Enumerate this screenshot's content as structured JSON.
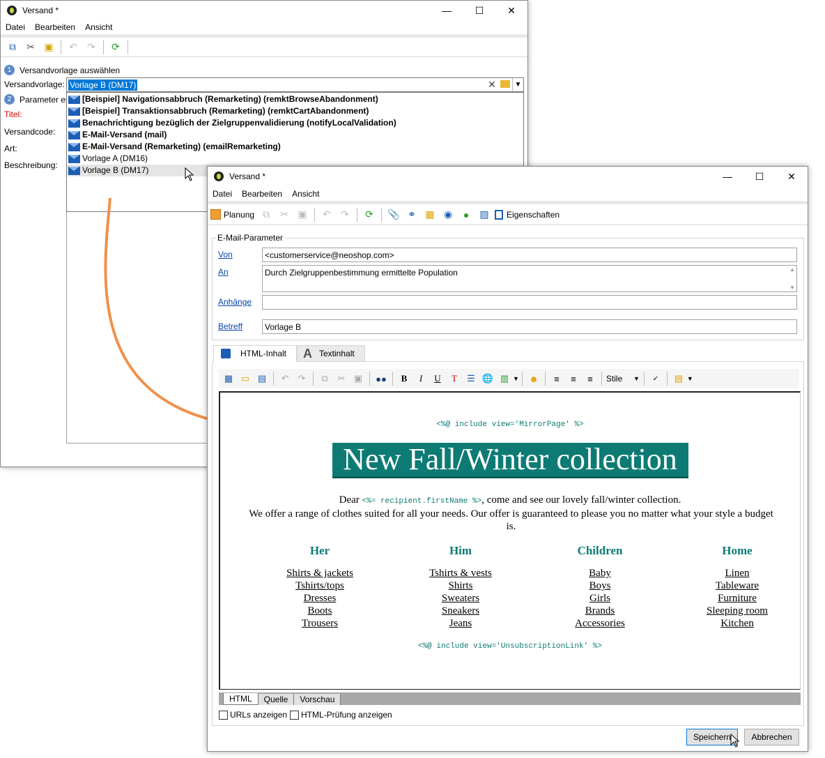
{
  "win1": {
    "title": "Versand *",
    "menu": [
      "Datei",
      "Bearbeiten",
      "Ansicht"
    ],
    "step1": {
      "num": "1",
      "label": "Versandvorlage auswählen"
    },
    "step2": {
      "num": "2",
      "label": "Parameter er"
    },
    "labels": {
      "template": "Versandvorlage:",
      "title": "Titel:",
      "code": "Versandcode:",
      "kind": "Art:",
      "desc": "Beschreibung:"
    },
    "template_value": "Vorlage B (DM17)",
    "dropdown": [
      "[Beispiel] Navigationsabbruch (Remarketing) (remktBrowseAbandonment)",
      "[Beispiel] Transaktionsabbruch (Remarketing) (remktCartAbandonment)",
      "Benachrichtigung bezüglich der Zielgruppenvalidierung (notifyLocalValidation)",
      "E-Mail-Versand (mail)",
      "E-Mail-Versand (Remarketing) (emailRemarketing)",
      "Vorlage A (DM16)",
      "Vorlage B (DM17)"
    ]
  },
  "win2": {
    "title": "Versand *",
    "menu": [
      "Datei",
      "Bearbeiten",
      "Ansicht"
    ],
    "toolbar": {
      "plan": "Planung",
      "props": "Eigenschaften"
    },
    "group_label": "E-Mail-Parameter",
    "from_label": "Von",
    "from_value": "<customerservice@neoshop.com>",
    "to_label": "An",
    "to_value": "Durch Zielgruppenbestimmung ermittelte Population",
    "attach_label": "Anhänge",
    "subject_label": "Betreff",
    "subject_value": "Vorlage B",
    "tab_html": "HTML-Inhalt",
    "tab_text": "Textinhalt",
    "style_label": "Stile",
    "content": {
      "include_mirror": "<%@ include view='MirrorPage' %>",
      "headline": "New Fall/Winter collection",
      "dear": "Dear",
      "recipient_tag": "<%= recipient.firstName %>",
      "greeting_rest": ", come and see our lovely fall/winter collection.",
      "intro": "We offer a range of clothes suited for all your needs. Our offer is guaranteed to please you no matter what your style a budget is.",
      "columns": [
        {
          "title": "Her",
          "items": [
            "Shirts & jackets",
            "Tshirts/tops",
            "Dresses",
            "Boots",
            "Trousers"
          ]
        },
        {
          "title": "Him",
          "items": [
            "Tshirts & vests",
            "Shirts",
            "Sweaters",
            "Sneakers",
            "Jeans"
          ]
        },
        {
          "title": "Children",
          "items": [
            "Baby",
            "Boys",
            "Girls",
            "Brands",
            "Accessories"
          ]
        },
        {
          "title": "Home",
          "items": [
            "Linen",
            "Tableware",
            "Furniture",
            "Sleeping room",
            "Kitchen"
          ]
        }
      ],
      "include_unsub": "<%@ include view='UnsubscriptionLink' %>"
    },
    "bottom_tabs": [
      "HTML",
      "Quelle",
      "Vorschau"
    ],
    "check_urls": "URLs anzeigen",
    "check_html": "HTML-Prüfung anzeigen",
    "save": "Speichern",
    "cancel": "Abbrechen"
  },
  "colors": {
    "accent_teal": "#0d7b74",
    "selection": "#0078d7",
    "arrow": "#f0914a",
    "link": "#0645ad"
  }
}
